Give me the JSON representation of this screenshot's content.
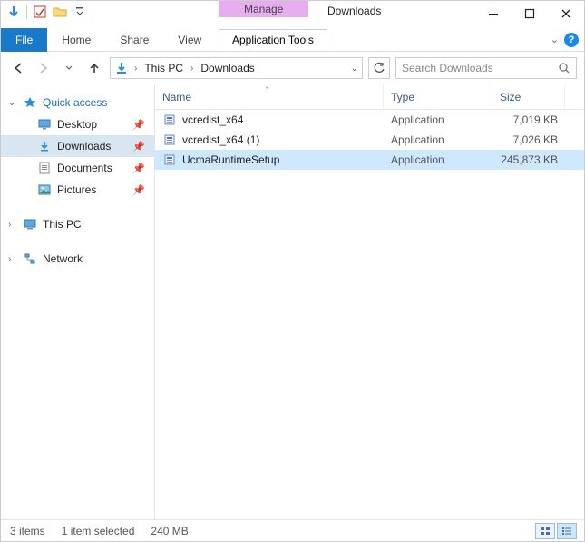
{
  "titlebar": {
    "manage_label": "Manage",
    "title": "Downloads"
  },
  "ribbon": {
    "file": "File",
    "tabs": [
      "Home",
      "Share",
      "View"
    ],
    "context_tab": "Application Tools"
  },
  "address": {
    "segments": [
      "This PC",
      "Downloads"
    ],
    "search_placeholder": "Search Downloads"
  },
  "nav": {
    "quick_access": "Quick access",
    "items": [
      {
        "label": "Desktop"
      },
      {
        "label": "Downloads"
      },
      {
        "label": "Documents"
      },
      {
        "label": "Pictures"
      }
    ],
    "this_pc": "This PC",
    "network": "Network"
  },
  "columns": {
    "name": "Name",
    "type": "Type",
    "size": "Size"
  },
  "files": [
    {
      "name": "vcredist_x64",
      "type": "Application",
      "size": "7,019 KB",
      "selected": false
    },
    {
      "name": "vcredist_x64 (1)",
      "type": "Application",
      "size": "7,026 KB",
      "selected": false
    },
    {
      "name": "UcmaRuntimeSetup",
      "type": "Application",
      "size": "245,873 KB",
      "selected": true
    }
  ],
  "status": {
    "count": "3 items",
    "selected": "1 item selected",
    "size": "240 MB"
  }
}
